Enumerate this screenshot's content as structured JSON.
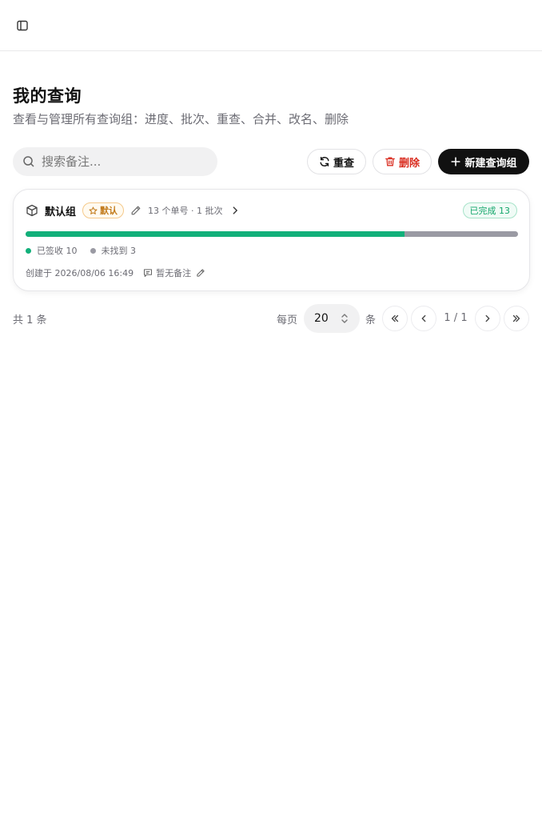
{
  "header": {
    "toggle_icon": "sidebar-toggle-icon"
  },
  "page": {
    "title": "我的查询",
    "subtitle": "查看与管理所有查询组：进度、批次、重查、合并、改名、删除"
  },
  "toolbar": {
    "search_placeholder": "搜索备注...",
    "search_value": "",
    "reset_label": "重查",
    "delete_label": "删除",
    "new_label": "新建查询组"
  },
  "group_card": {
    "name": "默认组",
    "default_badge": "默认",
    "meta": "13 个单号 · 1 批次",
    "status": "已完成 13",
    "progress": {
      "signed": 10,
      "not_found": 3,
      "total": 13
    },
    "legend_signed": "已签收 10",
    "legend_not_found": "未找到 3",
    "created": "创建于 2026/08/06 16:49",
    "note": "暂无备注"
  },
  "pagination": {
    "total": "共 1 条",
    "per_page_label": "每页",
    "page_size": "20",
    "per_page_unit": "条",
    "page_indicator": "1 / 1"
  },
  "colors": {
    "accent": "#111111",
    "signed": "#12b07a",
    "not_found": "#9a9aa3",
    "danger": "#d92d20",
    "default_badge": "#c27a1a"
  }
}
